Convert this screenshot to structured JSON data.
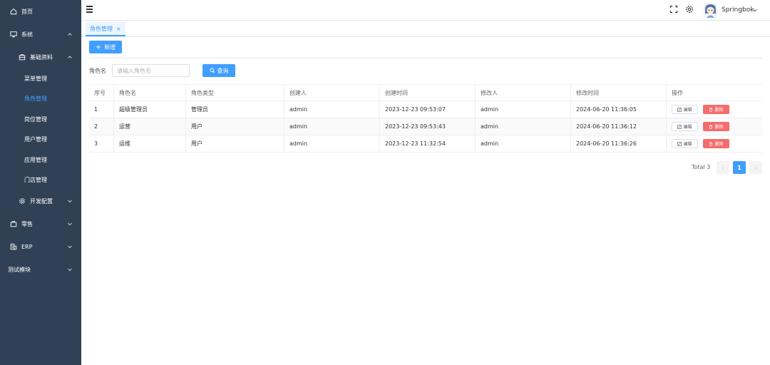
{
  "sidebar": {
    "items": [
      {
        "label": "首页",
        "icon": "home-icon"
      },
      {
        "label": "系统",
        "icon": "monitor-icon"
      },
      {
        "label": "基础资料",
        "icon": "briefcase-icon"
      },
      {
        "label": "菜单管理"
      },
      {
        "label": "角色管理"
      },
      {
        "label": "岗位管理"
      },
      {
        "label": "用户管理"
      },
      {
        "label": "应用管理"
      },
      {
        "label": "门店管理"
      },
      {
        "label": "开发配置",
        "icon": "gear-icon"
      },
      {
        "label": "零售",
        "icon": "bag-icon"
      },
      {
        "label": "ERP",
        "icon": "building-icon"
      },
      {
        "label": "测试模块"
      }
    ],
    "active_color": "#409eff",
    "bg_color": "#304156"
  },
  "header": {
    "username": "Springbok"
  },
  "tags": {
    "active_tab": "角色管理",
    "close_glyph": "×"
  },
  "toolbar": {
    "add_label": "新增",
    "add_glyph": "+"
  },
  "search": {
    "label": "角色名",
    "placeholder": "请输入角色名",
    "query_label": "查询"
  },
  "table": {
    "columns": [
      "序号",
      "角色名",
      "角色类型",
      "创建人",
      "创建时间",
      "修改人",
      "修改时间",
      "操作"
    ],
    "rows": [
      {
        "index": "1",
        "name": "超级管理员",
        "type": "管理员",
        "creator": "admin",
        "created": "2023-12-23 09:53:07",
        "modifier": "admin",
        "modified": "2024-06-20 11:36:05"
      },
      {
        "index": "2",
        "name": "运营",
        "type": "用户",
        "creator": "admin",
        "created": "2023-12-23 09:53:43",
        "modifier": "admin",
        "modified": "2024-06-20 11:36:12"
      },
      {
        "index": "3",
        "name": "运维",
        "type": "用户",
        "creator": "admin",
        "created": "2023-12-23 11:32:54",
        "modifier": "admin",
        "modified": "2024-06-20 11:36:26"
      }
    ],
    "edit_label": "编辑",
    "delete_label": "删除"
  },
  "pagination": {
    "total_label": "Total 3",
    "current_page": "1",
    "prev_glyph": "‹",
    "next_glyph": "›"
  },
  "colors": {
    "primary": "#409eff",
    "danger": "#f56c6c"
  }
}
